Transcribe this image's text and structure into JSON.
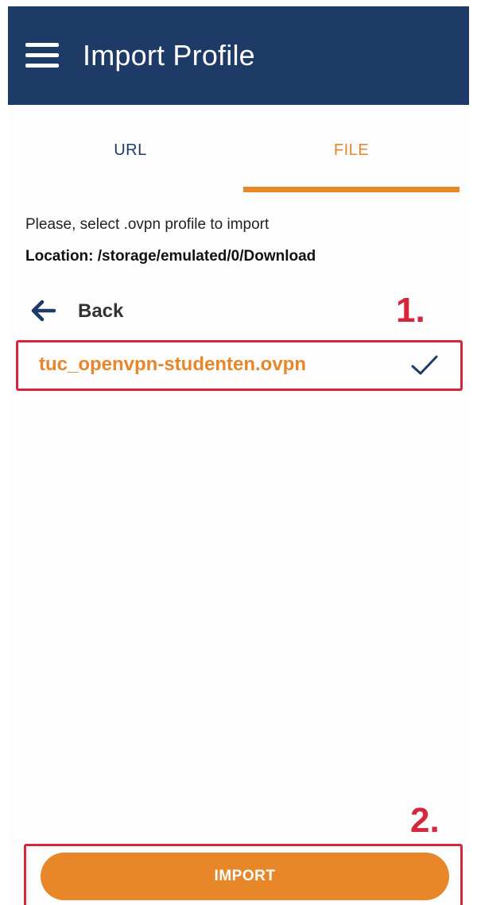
{
  "app_bar": {
    "title": "Import Profile",
    "menu_icon": "hamburger-menu-icon"
  },
  "tabs": [
    {
      "label": "URL",
      "selected": false
    },
    {
      "label": "FILE",
      "selected": true
    }
  ],
  "file_picker": {
    "instruction": "Please, select .ovpn profile to import",
    "location": "Location: /storage/emulated/0/Download",
    "back_label": "Back",
    "back_icon": "arrow-left-icon",
    "files": [
      {
        "name": "tuc_openvpn-studenten.ovpn",
        "selected": true,
        "icon": "checkmark-icon"
      }
    ]
  },
  "annotations": {
    "step1": "1.",
    "step2": "2."
  },
  "import_button": {
    "label": "IMPORT"
  },
  "colors": {
    "app_bar": "#1e3a66",
    "accent": "#e8862a",
    "annotation": "#d6263b"
  }
}
